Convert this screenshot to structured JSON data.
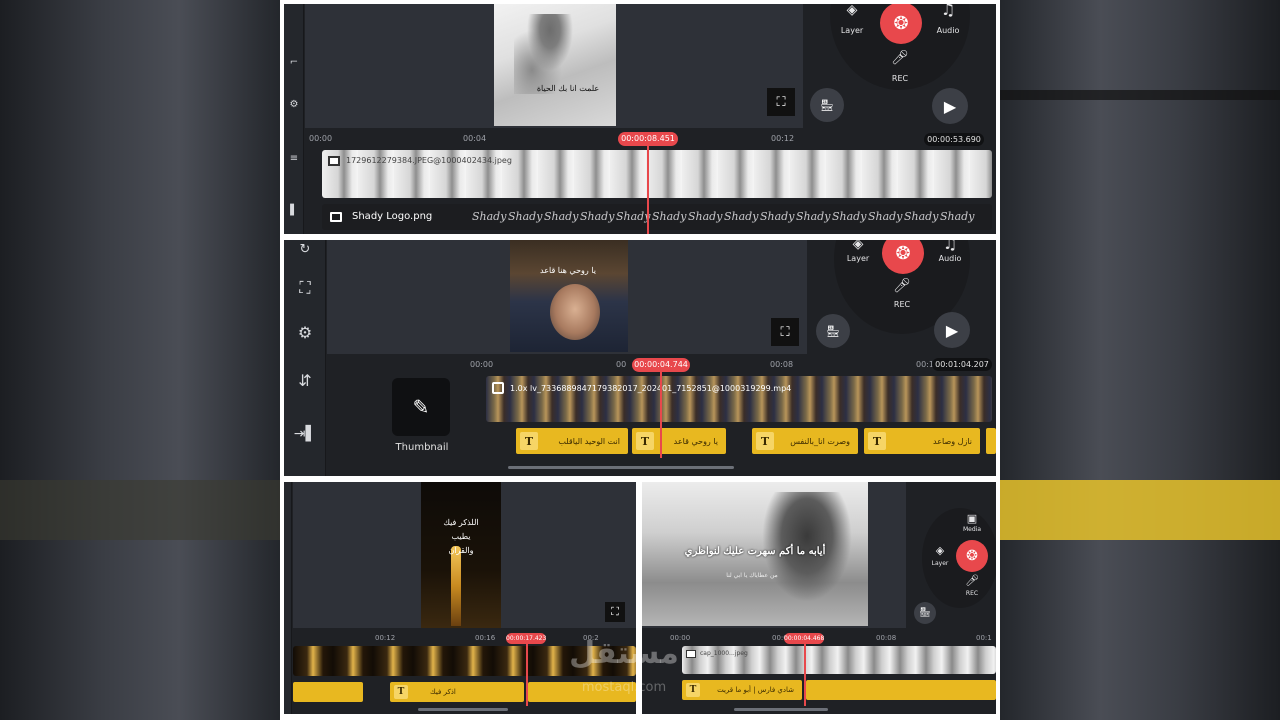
{
  "p1": {
    "wheel": {
      "layer": "Layer",
      "audio": "Audio",
      "rec": "REC"
    },
    "caption": "علمت انا بك الحياة",
    "ruler": {
      "t0": "00:00",
      "t1": "00:04",
      "t2": "00:12",
      "t3": "0"
    },
    "playhead_time": "00:00:08.451",
    "total_time": "00:00:53.690",
    "clip_name": "1729612279384.JPEG@1000402434.jpeg",
    "logo_name": "Shady Logo.png",
    "logo_word": "Shady"
  },
  "p2": {
    "wheel": {
      "layer": "Layer",
      "audio": "Audio",
      "rec": "REC"
    },
    "caption": "يا روحي هنا قاعد",
    "ruler": {
      "t0": "00:00",
      "t1": "00",
      "t2": "00:08",
      "t3": "00:1"
    },
    "playhead_time": "00:00:04.744",
    "total_time": "00:01:04.207",
    "thumbnail_label": "Thumbnail",
    "clip_name": "1.0x lv_7336889847179382017_202401_7152851@1000319299.mp4",
    "text_clips": [
      "انت الوحيد الياقلب",
      "يا روحي قاعد",
      "وصرت انا_بالنفس",
      "نازل وصاعد"
    ]
  },
  "p3": {
    "caption_lines": [
      "اللذكر فيك",
      "يطيب",
      "والقران"
    ],
    "ruler": {
      "t0": "00:12",
      "t1": "00:16",
      "t2": "00:2"
    },
    "playhead_time": "00:00:17.423",
    "text_clip": "اذكر فيك"
  },
  "p4": {
    "wheel": {
      "media": "Media",
      "layer": "Layer",
      "rec": "REC"
    },
    "caption": "أيابه ما أكم سهرت عليك لنواظري",
    "subcaption": "من عطاياك يا ابي لنا",
    "ruler": {
      "t0": "00:00",
      "t1": "00:0",
      "t2": "00:08",
      "t3": "00:1"
    },
    "playhead_time": "00:00:04.468",
    "clip_name": "cap_1000...jpeg",
    "text_clip": "شادي فارس | أبو ما قريت"
  },
  "watermark": {
    "arabic": "مستقل",
    "latin": "mostaql.com"
  },
  "colors": {
    "accent": "#e8484c",
    "text_clip": "#e8b820",
    "panel": "#1f2125",
    "preview": "#2e3138"
  }
}
